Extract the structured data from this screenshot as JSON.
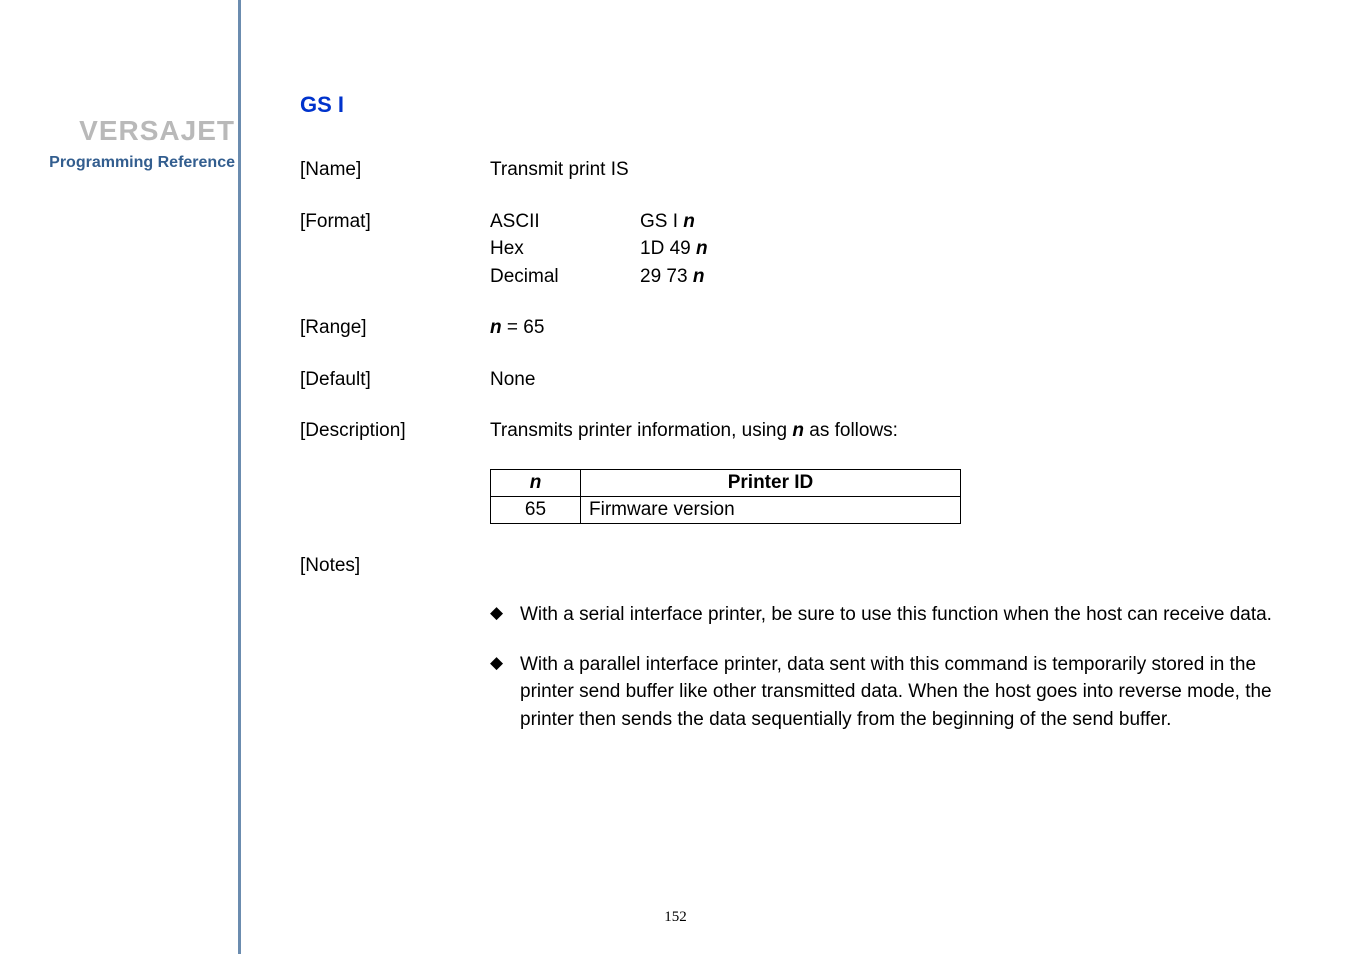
{
  "sidebar": {
    "brand": "VERSAJET",
    "subtitle": "Programming Reference"
  },
  "heading": "GS I",
  "rows": {
    "name": {
      "label": "[Name]",
      "value": "Transmit print IS"
    },
    "format": {
      "label": "[Format]",
      "ascii_l": "ASCII",
      "ascii_v_pre": "GS I ",
      "ascii_v_n": "n",
      "hex_l": "Hex",
      "hex_v_pre": "1D 49 ",
      "hex_v_n": "n",
      "dec_l": "Decimal",
      "dec_v_pre": "29 73 ",
      "dec_v_n": "n"
    },
    "range": {
      "label": "[Range]",
      "n": "n",
      "eq": " = 65"
    },
    "default": {
      "label": "[Default]",
      "value": "None"
    },
    "description": {
      "label": "[Description]",
      "pre": "Transmits printer information, using ",
      "n": "n",
      "post": " as follows:"
    }
  },
  "table": {
    "h_n": "n",
    "h_pid": "Printer ID",
    "r1_n": "65",
    "r1_pid": "Firmware version"
  },
  "notes": {
    "label": "[Notes]",
    "b1": "With a serial interface printer, be sure to use this function when the host can receive data.",
    "b2": "With a parallel interface printer, data sent with this command is temporarily stored in the printer send buffer like other transmitted data. When the host goes into reverse mode, the printer then sends the data sequentially from the beginning of the send buffer."
  },
  "page": "152"
}
